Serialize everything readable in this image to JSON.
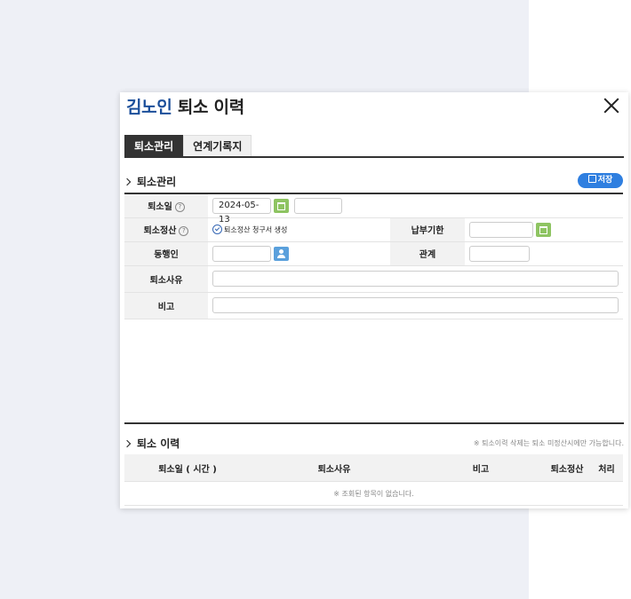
{
  "modal": {
    "title_name": "김노인",
    "title_rest": " 퇴소 이력"
  },
  "tabs": [
    "퇴소관리",
    "연계기록지"
  ],
  "section1": {
    "title": "퇴소관리",
    "save_label": "저장",
    "discharge_date_label": "퇴소일",
    "discharge_date_value": "2024-05-13",
    "settlement_label": "퇴소정산",
    "settlement_check_label": "퇴소정산 청구서 생성",
    "due_label": "납부기한",
    "companion_label": "동행인",
    "relation_label": "관계",
    "reason_label": "퇴소사유",
    "note_label": "비고",
    "help_mark": "?"
  },
  "section2": {
    "title": "퇴소 이력",
    "note": "※ 퇴소이력 삭제는 퇴소 미정산시에만 가능합니다.",
    "columns": [
      "퇴소일 ( 시간 )",
      "퇴소사유",
      "비고",
      "퇴소정산",
      "처리"
    ],
    "empty_message": "※ 조회된 항목이 없습니다."
  },
  "colors": {
    "accent": "#2f7fe0",
    "title_name": "#1a4e9a",
    "calendar_button": "#8ec462"
  }
}
